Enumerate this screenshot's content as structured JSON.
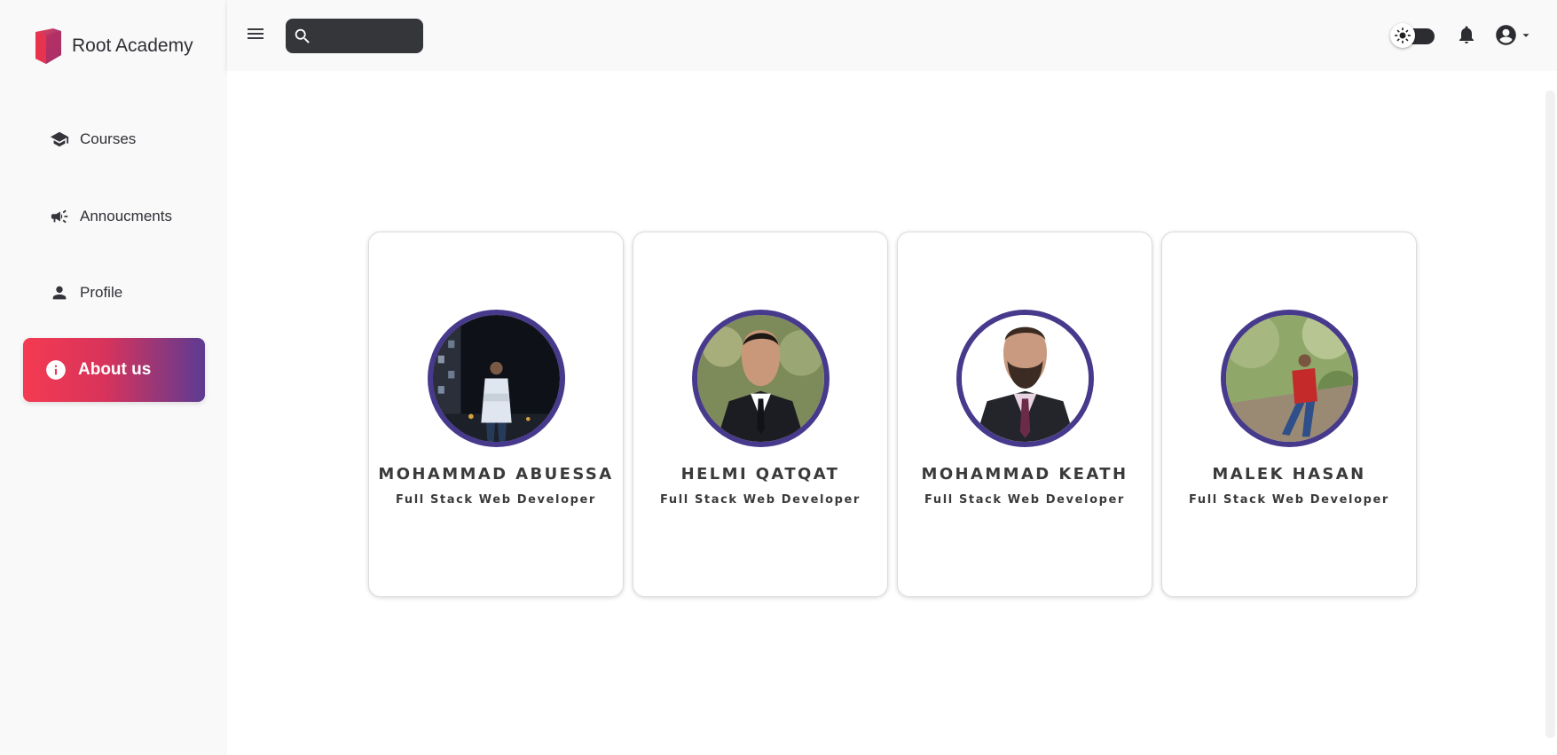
{
  "app": {
    "brand_name": "Root Academy",
    "brand_colors": {
      "primary": "#f43b51",
      "secondary": "#5c3b93"
    }
  },
  "sidebar": {
    "items": [
      {
        "label": "Courses",
        "icon": "graduation-cap-icon",
        "active": false
      },
      {
        "label": "Annoucments",
        "icon": "megaphone-icon",
        "active": false
      },
      {
        "label": "Profile",
        "icon": "person-icon",
        "active": false
      },
      {
        "label": "About us",
        "icon": "info-icon",
        "active": true
      }
    ]
  },
  "topbar": {
    "menu_icon": "hamburger-menu-icon",
    "search": {
      "value": "",
      "placeholder": "",
      "icon": "search-icon"
    },
    "theme_toggle": {
      "icon": "sun-icon",
      "state": "light"
    },
    "notifications_icon": "bell-icon",
    "account_icon": "account-circle-icon"
  },
  "team": {
    "members": [
      {
        "name": "MOHAMMAD ABUESSA",
        "role": "Full Stack Web Developer"
      },
      {
        "name": "HELMI QATQAT",
        "role": "Full Stack Web Developer"
      },
      {
        "name": "MOHAMMAD KEATH",
        "role": "Full Stack Web Developer"
      },
      {
        "name": "MALEK HASAN",
        "role": "Full Stack Web Developer"
      }
    ],
    "avatar_ring_color": "#473a8c"
  }
}
